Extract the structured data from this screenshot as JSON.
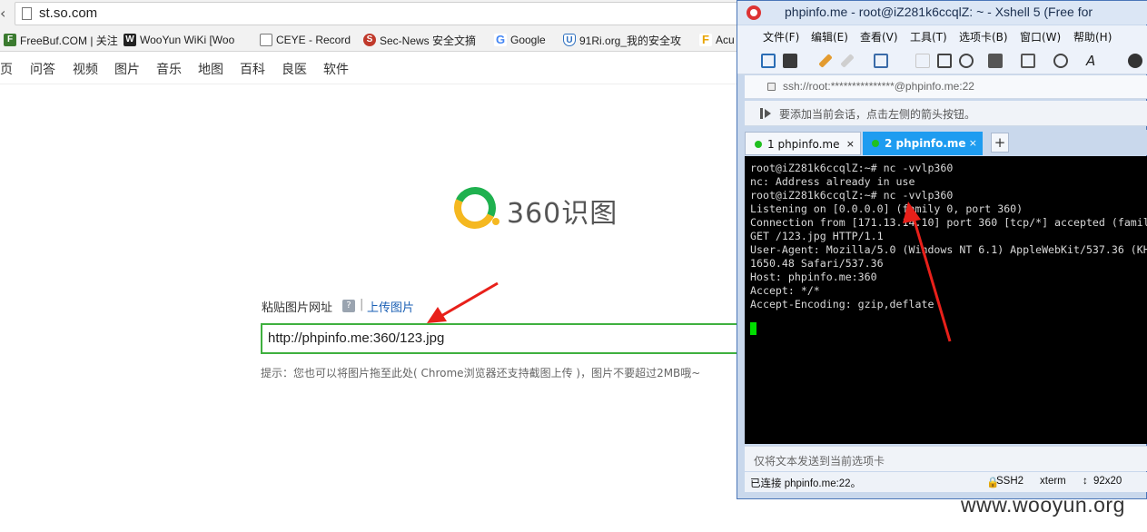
{
  "browser": {
    "url": "st.so.com",
    "bookmarks": [
      {
        "icon": "freebuf-icon",
        "label": "FreeBuf.COM | 关注",
        "color": "#3a7a2f"
      },
      {
        "icon": "wooyun-icon",
        "label": "WooYun WiKi [Woo",
        "color": "#222222"
      },
      {
        "icon": "page-icon",
        "label": "CEYE - Record",
        "color": "#ffffff"
      },
      {
        "icon": "secnews-icon",
        "label": "Sec-News 安全文摘",
        "color": "#c0392b"
      },
      {
        "icon": "google-icon",
        "label": "Google",
        "color": "#4285f4"
      },
      {
        "icon": "shield-icon",
        "label": "91Ri.org_我的安全攻",
        "color": "#2c6fbf"
      },
      {
        "icon": "acunetix-icon",
        "label": "Acu",
        "color": "#e8a400"
      }
    ],
    "nav": [
      "页",
      "问答",
      "视频",
      "图片",
      "音乐",
      "地图",
      "百科",
      "良医",
      "软件"
    ]
  },
  "search": {
    "logo_text": "360识图",
    "paste_label": "粘贴图片网址",
    "help_label": "?",
    "separator": "|",
    "upload_link": "上传图片",
    "input_value": "http://phpinfo.me:360/123.jpg",
    "hint": "提示：您也可以将图片拖至此处( Chrome浏览器还支持截图上传 )，图片不要超过2MB哦~"
  },
  "xshell": {
    "title": "phpinfo.me - root@iZ281k6ccqlZ: ~ - Xshell 5 (Free for",
    "menu": [
      "文件(F)",
      "编辑(E)",
      "查看(V)",
      "工具(T)",
      "选项卡(B)",
      "窗口(W)",
      "帮助(H)"
    ],
    "address": "ssh://root:***************@phpinfo.me:22",
    "tip": "要添加当前会话，点击左侧的箭头按钮。",
    "tabs": [
      {
        "label": "1 phpinfo.me",
        "close": "×"
      },
      {
        "label": "2 phpinfo.me",
        "close": "×"
      }
    ],
    "add_tab": "+",
    "terminal_lines": [
      "root@iZ281k6ccqlZ:~# nc -vvlp360",
      "nc: Address already in use",
      "root@iZ281k6ccqlZ:~# nc -vvlp360",
      "Listening on [0.0.0.0] (family 0, port 360)",
      "Connection from [171.13.14.10] port 360 [tcp/*] accepted (famil",
      "GET /123.jpg HTTP/1.1",
      "User-Agent: Mozilla/5.0 (Windows NT 6.1) AppleWebKit/537.36 (KH",
      "1650.48 Safari/537.36",
      "Host: phpinfo.me:360",
      "Accept: */*",
      "Accept-Encoding: gzip,deflate"
    ],
    "send_bar": "仅将文本发送到当前选项卡",
    "status": {
      "connected": "已连接 phpinfo.me:22。",
      "protocol": "SSH2",
      "term": "xterm",
      "size": "92x20"
    }
  },
  "colors": {
    "arrow": "#e8201a",
    "input_border": "#3fb03f",
    "tab_active": "#1e9cf0"
  },
  "watermark": "www.wooyun.org"
}
